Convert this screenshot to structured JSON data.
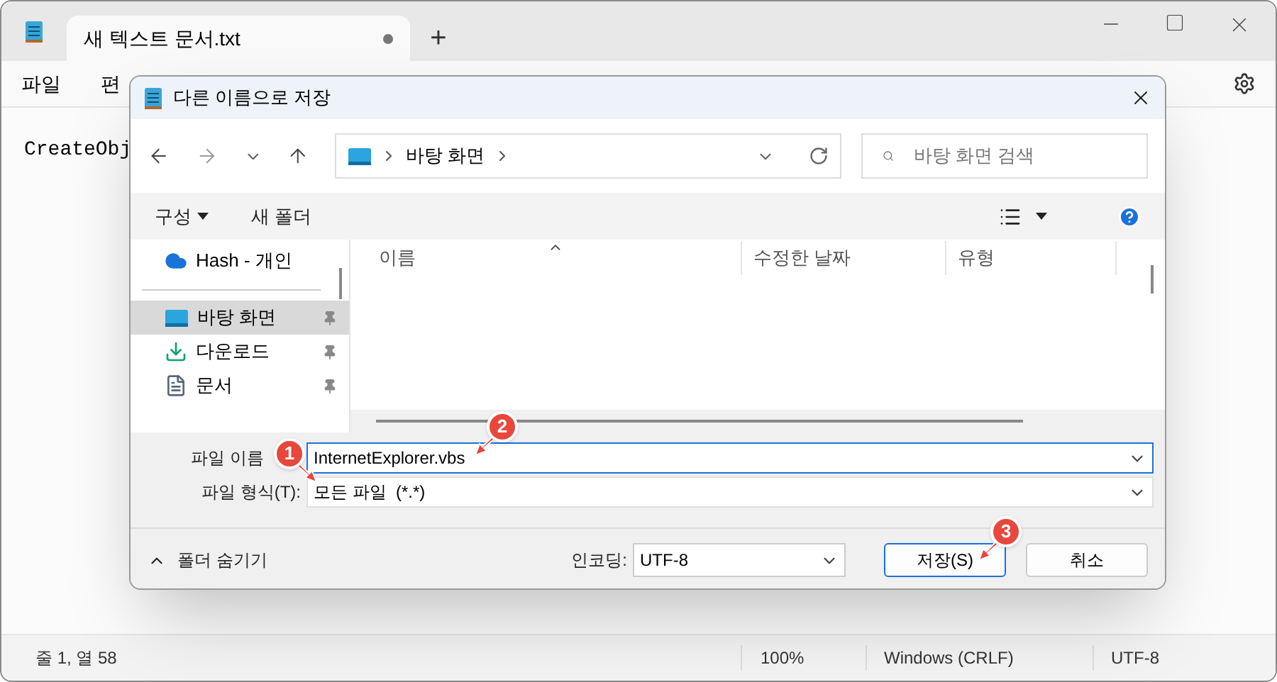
{
  "tab": {
    "title": "새 텍스트 문서.txt",
    "unsaved": true
  },
  "new_tab_button": "+",
  "menu": [
    "파일",
    "편"
  ],
  "editor": {
    "text": "CreateObj"
  },
  "status_bar": [
    "줄 1, 열 58",
    "100%",
    "Windows (CRLF)",
    "UTF-8"
  ],
  "dialog": {
    "title": "다른 이름으로 저장",
    "breadcrumb": [
      "바탕 화면"
    ],
    "search": {
      "placeholder": "바탕 화면 검색"
    },
    "toolbar": [
      {
        "label": "구성",
        "dropdown": true
      },
      {
        "label": "새 폴더",
        "dropdown": false
      }
    ],
    "sidebar": [
      {
        "label": "Hash - 개인",
        "kind": "cloud",
        "pinned": false,
        "selected": false
      },
      {
        "label": "바탕 화면",
        "kind": "desktop",
        "pinned": true,
        "selected": true
      },
      {
        "label": "다운로드",
        "kind": "download",
        "pinned": true,
        "selected": false
      },
      {
        "label": "문서",
        "kind": "document",
        "pinned": true,
        "selected": false
      }
    ],
    "columns": [
      "이름",
      "수정한 날짜",
      "유형"
    ],
    "file_name": {
      "label": "파일 이름",
      "value": "InternetExplorer.vbs"
    },
    "file_type": {
      "label": "파일 형식(T):",
      "value": "모든 파일  (*.*)"
    },
    "hide_folders": "폴더 숨기기",
    "encoding": {
      "label": "인코딩:",
      "value": "UTF-8"
    },
    "buttons": [
      {
        "label": "저장(S)",
        "primary": true
      },
      {
        "label": "취소",
        "primary": false
      }
    ]
  },
  "callouts": [
    "1",
    "2",
    "3"
  ]
}
